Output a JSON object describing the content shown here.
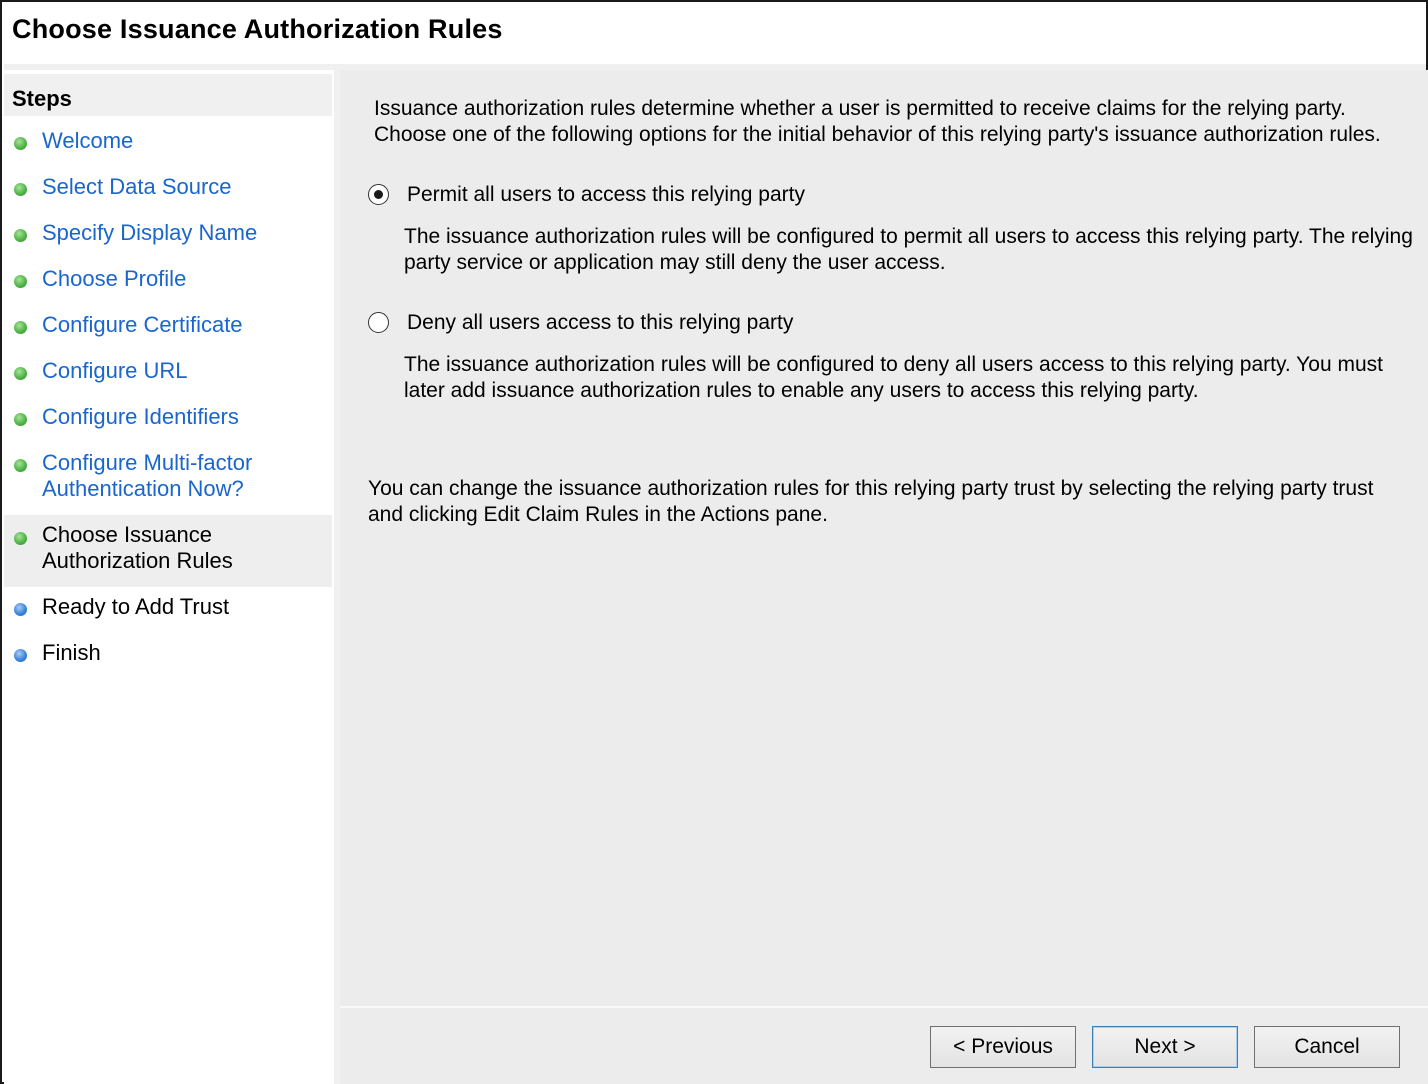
{
  "header": {
    "title": "Choose Issuance Authorization Rules"
  },
  "sidebar": {
    "heading": "Steps",
    "items": [
      {
        "label": "Welcome",
        "status": "complete"
      },
      {
        "label": "Select Data Source",
        "status": "complete"
      },
      {
        "label": "Specify Display Name",
        "status": "complete"
      },
      {
        "label": "Choose Profile",
        "status": "complete"
      },
      {
        "label": "Configure Certificate",
        "status": "complete"
      },
      {
        "label": "Configure URL",
        "status": "complete"
      },
      {
        "label": "Configure Identifiers",
        "status": "complete"
      },
      {
        "label": "Configure Multi-factor\nAuthentication Now?",
        "status": "complete"
      },
      {
        "label": "Choose Issuance\nAuthorization Rules",
        "status": "current"
      },
      {
        "label": "Ready to Add Trust",
        "status": "pending"
      },
      {
        "label": "Finish",
        "status": "pending"
      }
    ]
  },
  "main": {
    "intro": "Issuance authorization rules determine whether a user is permitted to receive claims for the relying party.\nChoose one of the following options for the initial behavior of this relying party's issuance authorization rules.",
    "options": [
      {
        "label": "Permit all users to access this relying party",
        "selected": true,
        "description": "The issuance authorization rules will be configured to permit all users to access this relying party. The relying\nparty service or application may still deny the user access."
      },
      {
        "label": "Deny all users access to this relying party",
        "selected": false,
        "description": "The issuance authorization rules will be configured to deny all users access to this relying party. You must\nlater add issuance authorization rules to enable any users to access this relying party."
      }
    ],
    "note": "You can change the issuance authorization rules for this relying party trust by selecting the relying party trust\nand clicking Edit Claim Rules in the Actions pane."
  },
  "buttons": {
    "previous": "< Previous",
    "next": "Next >",
    "cancel": "Cancel"
  },
  "colors": {
    "link": "#1a66cc",
    "complete_dot": "#52b548",
    "pending_dot": "#3d86d9",
    "panel_bg": "#ececec"
  }
}
